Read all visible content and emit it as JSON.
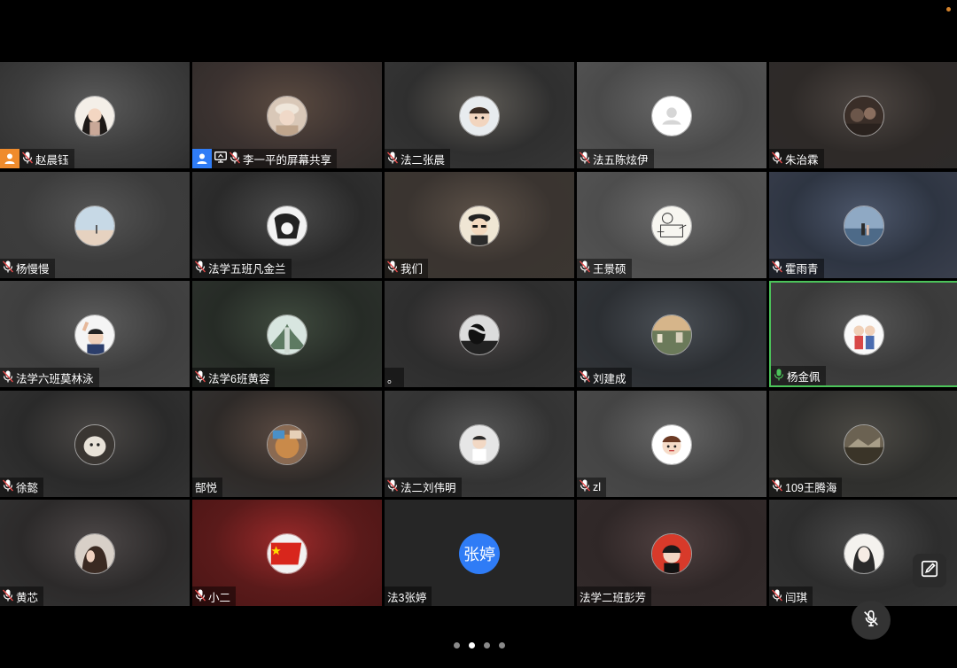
{
  "participants": [
    {
      "name": "赵晨钰",
      "mic": "muted",
      "badge": "host",
      "avatar": "girl-portrait",
      "bg": [
        "#3d3d3d",
        "#5a5a5a",
        "#2f2f2f"
      ]
    },
    {
      "name": "李一平的屏幕共享",
      "mic": "muted",
      "badge": "cohost",
      "share": true,
      "avatar": "girl-hat-photo",
      "bg": [
        "#3b3230",
        "#5a4a40",
        "#2f2b29"
      ]
    },
    {
      "name": "法二张晨",
      "mic": "muted",
      "avatar": "child-photo",
      "bg": [
        "#2f2f2f",
        "#5d5a55",
        "#363636"
      ]
    },
    {
      "name": "法五陈炫伊",
      "mic": "muted",
      "avatar": "default-user",
      "bg": [
        "#4a4a4a",
        "#666",
        "#555"
      ]
    },
    {
      "name": "朱治霖",
      "mic": "muted",
      "avatar": "dark-photo",
      "bg": [
        "#2e2a28",
        "#4d4642",
        "#2d2b2a"
      ]
    },
    {
      "name": "杨慢慢",
      "mic": "muted",
      "avatar": "sky-photo",
      "bg": [
        "#3c3c3c",
        "#555",
        "#3a3a3a"
      ]
    },
    {
      "name": "法学五班凡金兰",
      "mic": "muted",
      "avatar": "cartoon-bw",
      "bg": [
        "#2a2a2a",
        "#4a4a4a",
        "#333"
      ]
    },
    {
      "name": "我们",
      "mic": "muted",
      "avatar": "cartoon-emperor",
      "bg": [
        "#3a3430",
        "#5c5148",
        "#3b3631"
      ]
    },
    {
      "name": "王景硕",
      "mic": "muted",
      "avatar": "sketch-drawing",
      "bg": [
        "#4d4d4d",
        "#6b6b6b",
        "#555"
      ]
    },
    {
      "name": "霍雨青",
      "mic": "muted",
      "avatar": "beach-photo",
      "bg": [
        "#2e3542",
        "#4c566a",
        "#3a3f4d"
      ]
    },
    {
      "name": "法学六班莫林泳",
      "mic": "muted",
      "avatar": "cartoon-wave",
      "bg": [
        "#3e3e3e",
        "#5c5c5c",
        "#444"
      ]
    },
    {
      "name": "法学6班黄容",
      "mic": "muted",
      "avatar": "nature-photo",
      "bg": [
        "#262b26",
        "#3f4a3e",
        "#2d322d"
      ]
    },
    {
      "name": "。",
      "mic": "none",
      "avatar": "hand-photo",
      "bg": [
        "#2d2d2d",
        "#4d4848",
        "#333"
      ]
    },
    {
      "name": "刘建成",
      "mic": "muted",
      "avatar": "city-photo",
      "bg": [
        "#2c2f33",
        "#4a4f55",
        "#33363a"
      ]
    },
    {
      "name": "杨金佩",
      "mic": "active",
      "active": true,
      "avatar": "couple-cartoon",
      "bg": [
        "#3a3a3a",
        "#555",
        "#404040"
      ]
    },
    {
      "name": "徐懿",
      "mic": "muted",
      "avatar": "dog-photo",
      "bg": [
        "#2a2a2a",
        "#4a4745",
        "#333"
      ]
    },
    {
      "name": "郜悦",
      "mic": "none",
      "avatar": "food-photo",
      "bg": [
        "#2e2a28",
        "#5a4a42",
        "#333"
      ]
    },
    {
      "name": "法二刘伟明",
      "mic": "muted",
      "avatar": "baby-photo",
      "bg": [
        "#333",
        "#555",
        "#3a3a3a"
      ]
    },
    {
      "name": "zl",
      "mic": "muted",
      "avatar": "cartoon-girl",
      "bg": [
        "#444",
        "#666",
        "#4a4a4a"
      ]
    },
    {
      "name": "109王腾海",
      "mic": "muted",
      "avatar": "vintage-photo",
      "bg": [
        "#2f2f2d",
        "#4c4a45",
        "#363634"
      ]
    },
    {
      "name": "黄芯",
      "mic": "muted",
      "avatar": "hair-photo",
      "bg": [
        "#2c2a2a",
        "#4d4848",
        "#333"
      ]
    },
    {
      "name": "小二",
      "mic": "muted",
      "avatar": "flag",
      "bg": [
        "#5a1a1a",
        "#9a2a2a",
        "#4a1515"
      ]
    },
    {
      "name": "法3张婷",
      "mic": "none",
      "avatar": "text",
      "avatar_text": "张婷",
      "bg": [
        "#262626",
        "#262626",
        "#262626"
      ]
    },
    {
      "name": "法学二班彭芳",
      "mic": "none",
      "avatar": "boy-photo",
      "bg": [
        "#2f2727",
        "#4f4040",
        "#332b2b"
      ]
    },
    {
      "name": "闫琪",
      "mic": "muted",
      "avatar": "girl-sketch",
      "bg": [
        "#2d2d2d",
        "#4a4a4a",
        "#343434"
      ]
    }
  ],
  "pager": {
    "pages": 4,
    "current": 1
  },
  "colors": {
    "active_border": "#4cc35a",
    "host_badge": "#ef8b2c",
    "cohost_badge": "#2f7cf6",
    "text_avatar": "#2f7cf6"
  }
}
